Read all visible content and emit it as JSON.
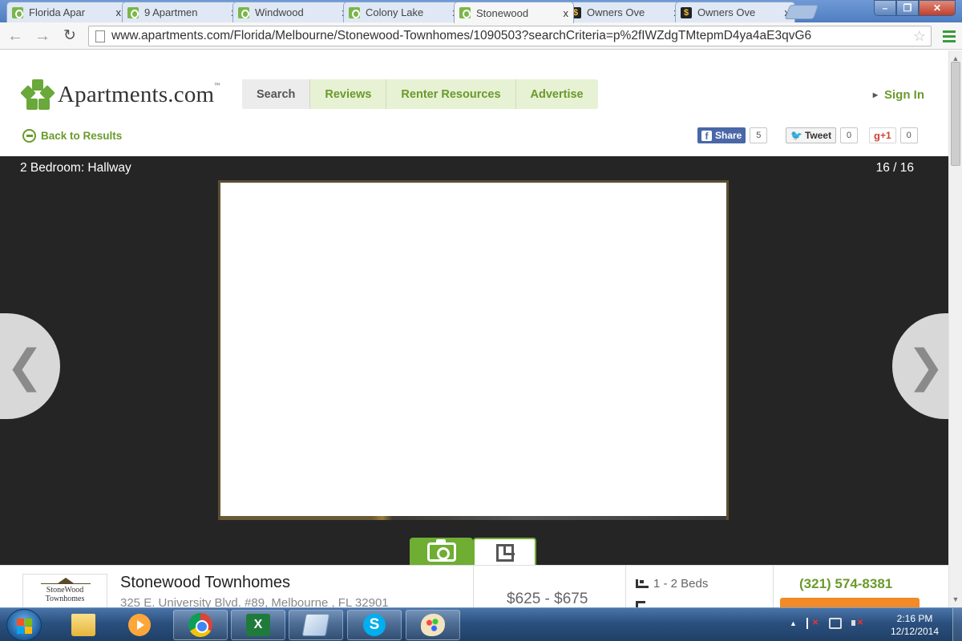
{
  "browser": {
    "tabs": [
      {
        "title": "Florida Apar",
        "favicon": "apartments-icon",
        "active": false
      },
      {
        "title": "9 Apartmen",
        "favicon": "apartments-icon",
        "active": false
      },
      {
        "title": "Windwood",
        "favicon": "apartments-icon",
        "active": false
      },
      {
        "title": "Colony Lake",
        "favicon": "apartments-icon",
        "active": false
      },
      {
        "title": "Stonewood",
        "favicon": "apartments-icon",
        "active": true
      },
      {
        "title": "Owners Ove",
        "favicon": "owners-icon",
        "active": false
      },
      {
        "title": "Owners Ove",
        "favicon": "owners-icon",
        "active": false
      }
    ],
    "close_glyph": "x",
    "url": "www.apartments.com/Florida/Melbourne/Stonewood-Townhomes/1090503?searchCriteria=p%2fIWZdgTMtepmD4ya4aE3qvG6"
  },
  "site": {
    "logo_text": "Apartments.com",
    "logo_tm": "™",
    "nav": [
      {
        "label": "Search",
        "active": true
      },
      {
        "label": "Reviews",
        "active": false
      },
      {
        "label": "Renter Resources",
        "active": false
      },
      {
        "label": "Advertise",
        "active": false
      }
    ],
    "sign_in": "Sign In",
    "back_to_results": "Back to Results",
    "social": {
      "facebook_label": "Share",
      "facebook_count": "5",
      "twitter_label": "Tweet",
      "twitter_count": "0",
      "gplus_label": "+1",
      "gplus_count": "0"
    },
    "brand_color": "#6a9a2c"
  },
  "gallery": {
    "caption": "2 Bedroom: Hallway",
    "counter": "16 / 16",
    "prev_glyph": "❮",
    "next_glyph": "❯"
  },
  "property": {
    "logo_line1": "StoneWood",
    "logo_line2": "Townhomes",
    "name": "Stonewood Townhomes",
    "address": "325 E. University Blvd. #89, Melbourne , FL 32901",
    "price": "$625 - $675",
    "beds": "1 - 2 Beds",
    "phone": "(321) 574-8381"
  },
  "taskbar": {
    "apps": [
      "start-button",
      "explorer",
      "media-player",
      "chrome",
      "excel",
      "notepad",
      "skype",
      "paint"
    ],
    "time": "2:16 PM",
    "date": "12/12/2014"
  }
}
